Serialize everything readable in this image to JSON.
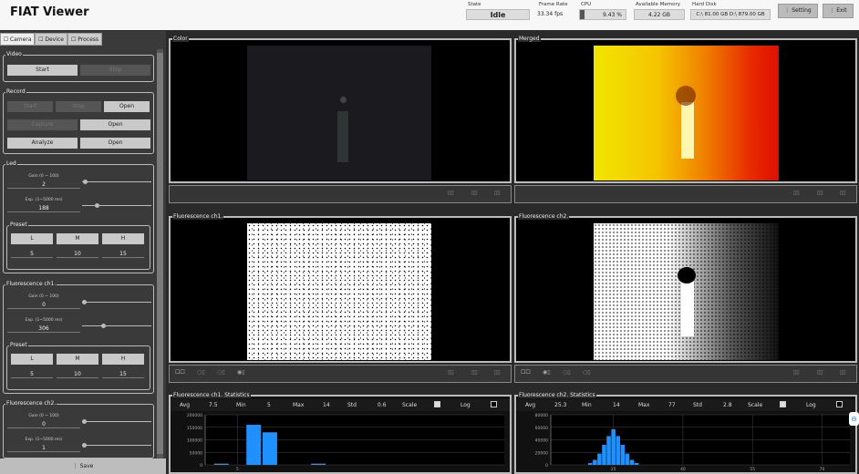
{
  "app": {
    "title": "FIAT Viewer"
  },
  "status": {
    "state_label": "State",
    "state_value": "Idle",
    "fps_label": "Frame Rate",
    "fps_value": "33.34 fps",
    "cpu_label": "CPU",
    "cpu_value": "9.43 %",
    "cpu_fraction": 0.094,
    "mem_label": "Available Memory",
    "mem_value": "4.22 GB",
    "disk_label": "Hard Disk",
    "disk_c": "C:\\ 81.00 GB",
    "disk_d": "D:\\ 879.00 GB"
  },
  "toolbar": {
    "setting": "Setting",
    "exit": "Exit"
  },
  "tabs": [
    "Camera",
    "Device",
    "Process"
  ],
  "video": {
    "label": "Video",
    "start": "Start",
    "stop": "Stop"
  },
  "record": {
    "label": "Record",
    "start": "Start",
    "stop": "Stop",
    "open1": "Open",
    "capture": "Capture",
    "open2": "Open",
    "analyze": "Analyze",
    "open3": "Open"
  },
  "led": {
    "label": "Led",
    "gain_label": "Gain (0 ~ 100)",
    "gain": "2",
    "gain_fraction": 0.02,
    "exp_label": "Exp. (1~5000 ms)",
    "exp": "188",
    "exp_fraction": 0.2,
    "preset": {
      "label": "Preset",
      "l": "L",
      "m": "M",
      "h": "H",
      "lv": "5",
      "mv": "10",
      "hv": "15"
    }
  },
  "fl1": {
    "label": "Fluorescence ch1.",
    "gain_label": "Gain (0 ~ 100)",
    "gain": "0",
    "gain_fraction": 0.0,
    "exp_label": "Exp. (1~5000 ms)",
    "exp": "306",
    "exp_fraction": 0.3,
    "preset": {
      "label": "Preset",
      "l": "L",
      "m": "M",
      "h": "H",
      "lv": "5",
      "mv": "10",
      "hv": "15"
    }
  },
  "fl2": {
    "label": "Fluorescence ch2.",
    "gain_label": "Gain (0 ~ 100)",
    "gain": "0",
    "gain_fraction": 0.0,
    "exp_label": "Exp. (1~5000 ms)",
    "exp": "1",
    "exp_fraction": 0.0
  },
  "save": "Save",
  "views": {
    "color": "Color",
    "merged": "Merged",
    "fl1": "Fluorescence ch1.",
    "fl2": "Fluorescence ch2."
  },
  "stats1": {
    "title": "Fluorescence ch1. Statistics",
    "avg_l": "Avg",
    "avg": "7.5",
    "min_l": "Min",
    "min": "5",
    "max_l": "Max",
    "max": "14",
    "std_l": "Std",
    "std": "0.6",
    "scale_l": "Scale",
    "scale_on": true,
    "log_l": "Log",
    "log_on": false
  },
  "stats2": {
    "title": "Fluorescence ch2. Statistics",
    "avg_l": "Avg",
    "avg": "25.3",
    "min_l": "Min",
    "min": "14",
    "max_l": "Max",
    "max": "77",
    "std_l": "Std",
    "std": "2.8",
    "scale_l": "Scale",
    "scale_on": true,
    "log_l": "Log",
    "log_on": false
  },
  "chart_data": [
    {
      "type": "bar",
      "yticks": [
        "200000",
        "150000",
        "100000",
        "50000",
        "0"
      ],
      "xticks": [
        "5"
      ],
      "ylim": [
        0,
        200000
      ],
      "x": [
        4,
        6,
        7,
        8,
        10
      ],
      "values": [
        5000,
        160000,
        130000,
        0,
        5000
      ],
      "color": "#1e90ff"
    },
    {
      "type": "bar",
      "yticks": [
        "80000",
        "60000",
        "40000",
        "20000",
        "0"
      ],
      "xticks": [
        "25",
        "40",
        "55",
        "70"
      ],
      "ylim": [
        0,
        80000
      ],
      "x": [
        20,
        21,
        22,
        23,
        24,
        25,
        26,
        27,
        28,
        29,
        30
      ],
      "values": [
        3000,
        8000,
        18000,
        32000,
        46000,
        57000,
        46000,
        32000,
        18000,
        8000,
        3000
      ],
      "color": "#1e90ff"
    }
  ]
}
